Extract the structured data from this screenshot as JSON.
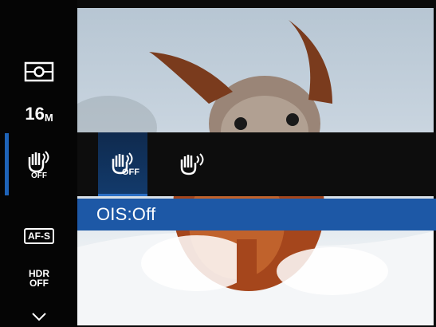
{
  "left_menu": {
    "items": [
      {
        "id": "metering",
        "icon": "metering-icon"
      },
      {
        "id": "image-size",
        "label_main": "16",
        "label_sub": "M"
      },
      {
        "id": "ois",
        "icon": "hand-shake-off-icon",
        "label": "OFF",
        "selected": true
      },
      {
        "id": "focus",
        "label": "AF-S"
      },
      {
        "id": "hdr",
        "label_line1": "HDR",
        "label_line2": "OFF"
      },
      {
        "id": "more",
        "icon": "chevron-down-icon"
      }
    ]
  },
  "submenu": {
    "options": [
      {
        "id": "ois-off",
        "icon": "hand-shake-off-icon",
        "label": "OFF",
        "selected": true
      },
      {
        "id": "ois-on",
        "icon": "hand-shake-icon"
      }
    ]
  },
  "status": {
    "text": "OIS:Off"
  },
  "colors": {
    "accent": "#1d58a6",
    "selected_bg": "#123a6b",
    "background": "#050505"
  }
}
